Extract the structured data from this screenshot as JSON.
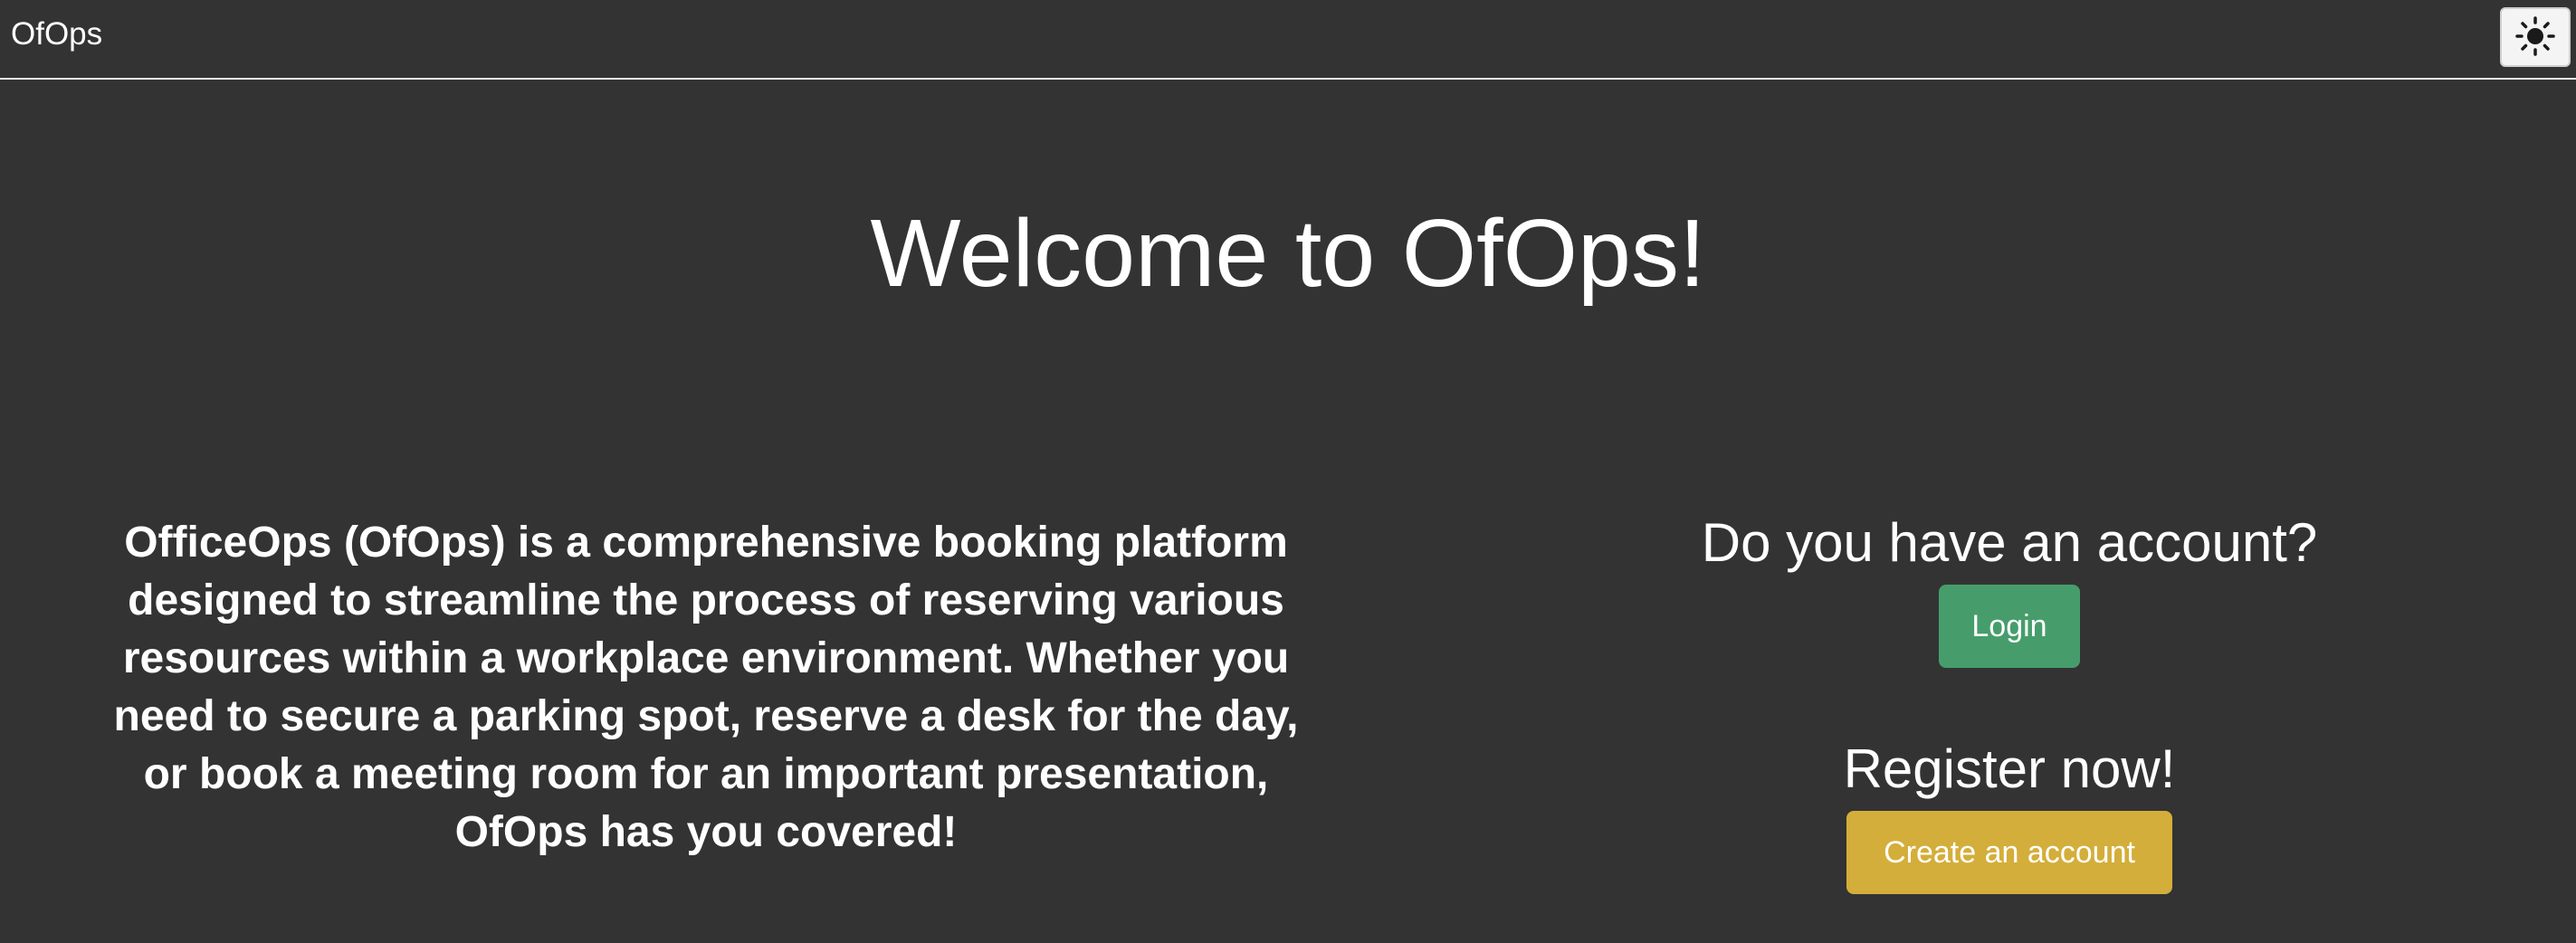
{
  "navbar": {
    "brand": "OfOps",
    "theme_toggle_icon": "sun-icon"
  },
  "main": {
    "heading": "Welcome to OfOps!",
    "description": "OfficeOps (OfOps) is a comprehensive booking platform designed to streamline the process of reserving various resources within a workplace environment. Whether you need to secure a parking spot, reserve a desk for the day, or book a meeting room for an important presentation, OfOps has you covered!"
  },
  "account": {
    "login_prompt": "Do you have an account?",
    "login_label": "Login",
    "register_prompt": "Register now!",
    "register_label": "Create an account"
  },
  "colors": {
    "background": "#333333",
    "login_button": "#469d6b",
    "register_button": "#d4ae3a"
  }
}
